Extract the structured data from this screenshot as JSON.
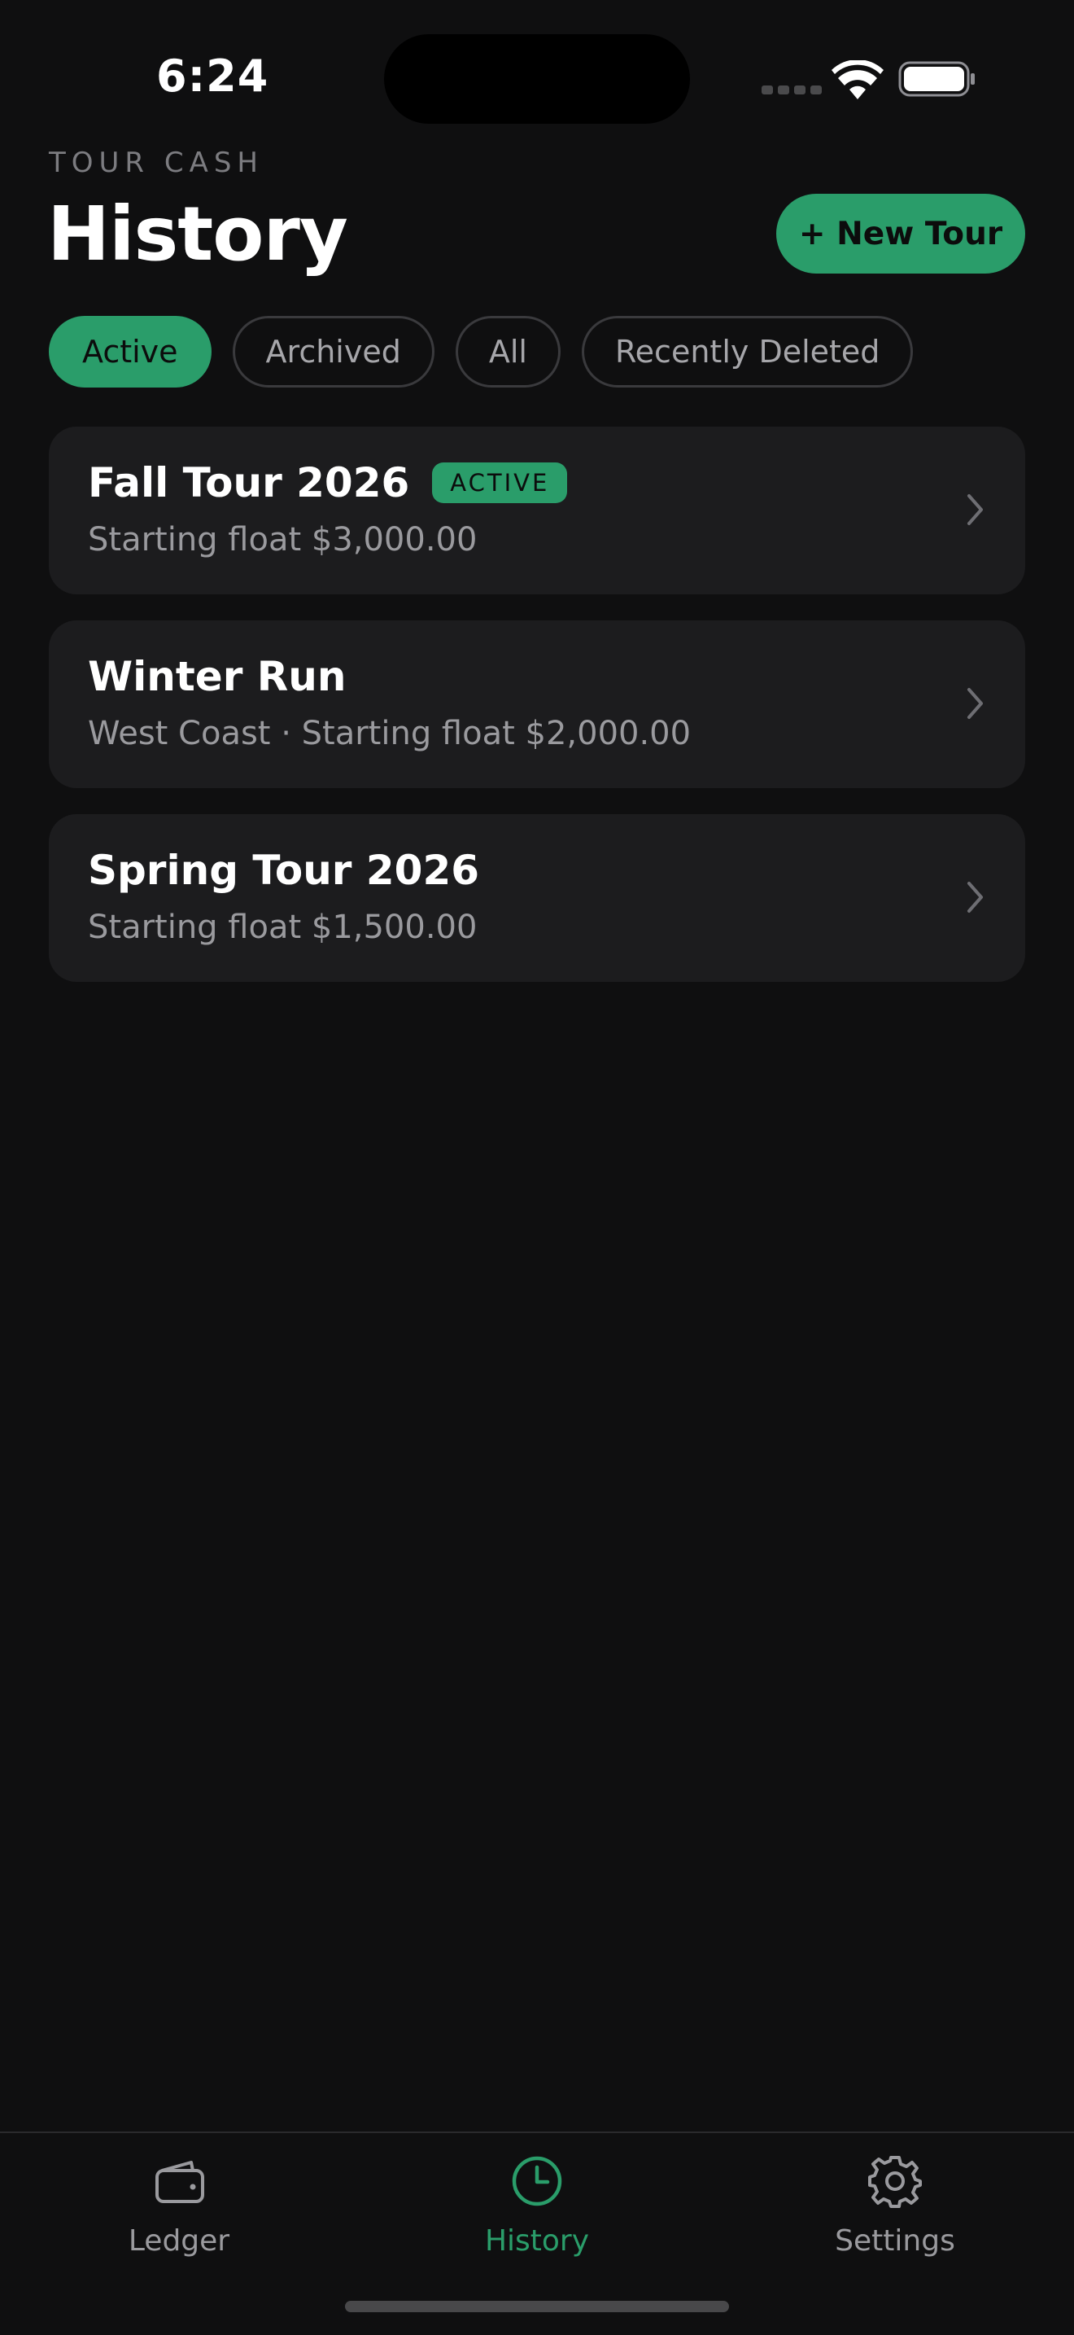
{
  "status_bar": {
    "time": "6:24"
  },
  "header": {
    "eyebrow": "TOUR CASH",
    "title": "History",
    "new_tour_label": "+ New Tour"
  },
  "filters": [
    {
      "label": "Active",
      "selected": true
    },
    {
      "label": "Archived",
      "selected": false
    },
    {
      "label": "All",
      "selected": false
    },
    {
      "label": "Recently Deleted",
      "selected": false
    }
  ],
  "tours": [
    {
      "name": "Fall Tour 2026",
      "badge": "ACTIVE",
      "subtitle": "Starting float $3,000.00"
    },
    {
      "name": "Winter Run",
      "badge": "",
      "subtitle": "West Coast · Starting float $2,000.00"
    },
    {
      "name": "Spring Tour 2026",
      "badge": "",
      "subtitle": "Starting float $1,500.00"
    }
  ],
  "tab_bar": {
    "items": [
      {
        "label": "Ledger",
        "icon": "wallet-icon",
        "selected": false
      },
      {
        "label": "History",
        "icon": "clock-icon",
        "selected": true
      },
      {
        "label": "Settings",
        "icon": "gear-icon",
        "selected": false
      }
    ]
  },
  "colors": {
    "background": "#0f0f10",
    "card": "#1c1c1e",
    "accent": "#2a9d6a",
    "muted_text": "#9a9a9e"
  }
}
